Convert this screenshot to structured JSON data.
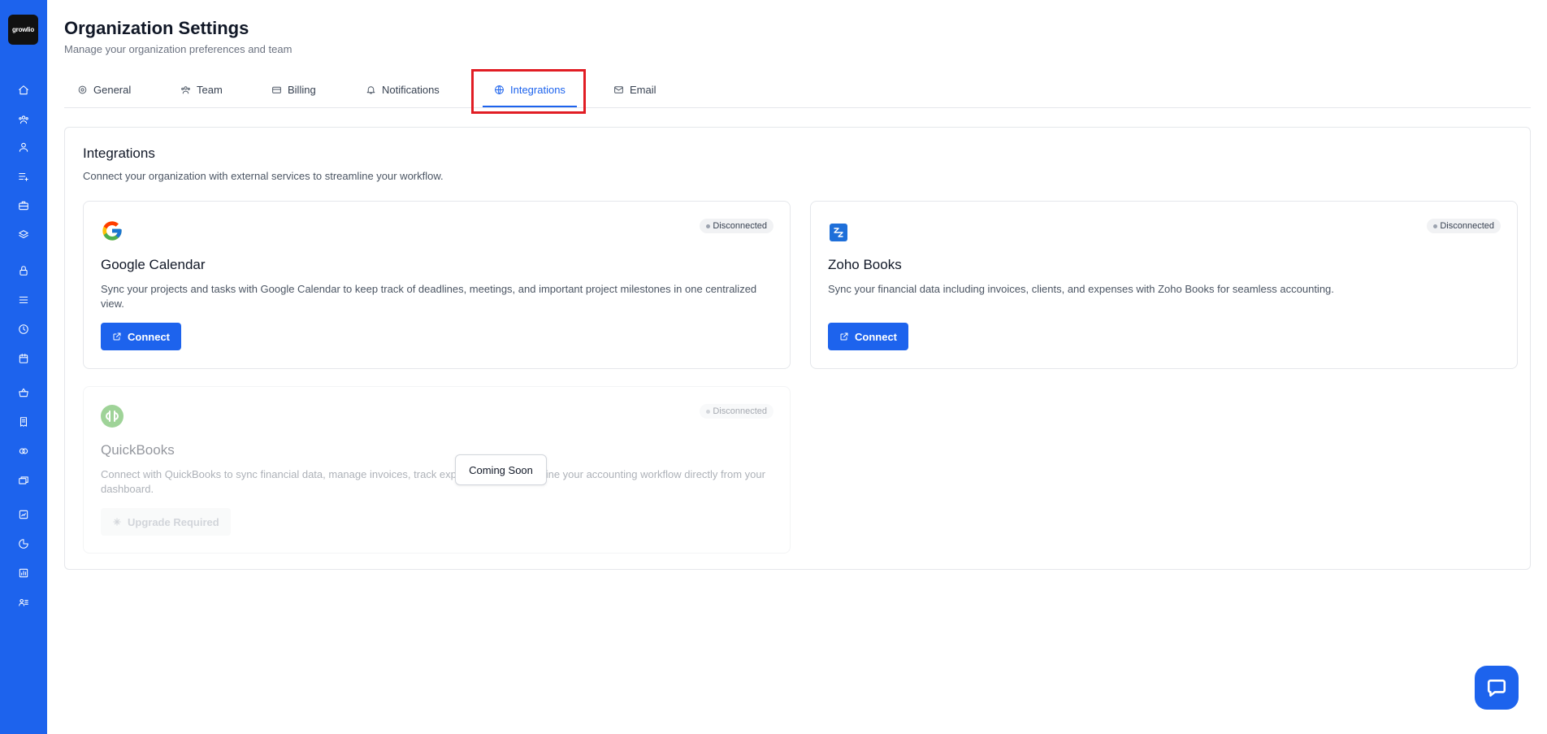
{
  "app": {
    "logo_text": "growlio"
  },
  "sidebar": {
    "items": [
      {
        "icon": "home-icon"
      },
      {
        "icon": "team-icon"
      },
      {
        "icon": "user-icon"
      },
      {
        "icon": "list-plus-icon"
      },
      {
        "icon": "briefcase-icon"
      },
      {
        "icon": "layers-icon"
      },
      {
        "icon": "lock-icon"
      },
      {
        "icon": "menu-icon"
      },
      {
        "icon": "clock-icon"
      },
      {
        "icon": "calendar-icon"
      },
      {
        "icon": "basket-icon"
      },
      {
        "icon": "receipt-icon"
      },
      {
        "icon": "coins-icon"
      },
      {
        "icon": "cards-icon"
      },
      {
        "icon": "report-icon"
      },
      {
        "icon": "pie-chart-icon"
      },
      {
        "icon": "chart-icon"
      },
      {
        "icon": "user-list-icon"
      }
    ]
  },
  "header": {
    "title": "Organization Settings",
    "subtitle": "Manage your organization preferences and team"
  },
  "tabs": [
    {
      "label": "General",
      "icon": "gear-icon"
    },
    {
      "label": "Team",
      "icon": "team-icon"
    },
    {
      "label": "Billing",
      "icon": "credit-card-icon"
    },
    {
      "label": "Notifications",
      "icon": "bell-icon"
    },
    {
      "label": "Integrations",
      "icon": "globe-icon",
      "active": true
    },
    {
      "label": "Email",
      "icon": "mail-icon"
    }
  ],
  "integrations": {
    "title": "Integrations",
    "subtitle": "Connect your organization with external services to streamline your workflow.",
    "cards": [
      {
        "name": "Google Calendar",
        "status": "Disconnected",
        "description": "Sync your projects and tasks with Google Calendar to keep track of deadlines, meetings, and important project milestones in one centralized view.",
        "button": "Connect"
      },
      {
        "name": "Zoho Books",
        "status": "Disconnected",
        "description": "Sync your financial data including invoices, clients, and expenses with Zoho Books for seamless accounting.",
        "button": "Connect"
      },
      {
        "name": "QuickBooks",
        "status": "Disconnected",
        "description": "Connect with QuickBooks to sync financial data, manage invoices, track expenses, and streamline your accounting workflow directly from your dashboard.",
        "button": "Upgrade Required",
        "tooltip": "Coming Soon"
      }
    ]
  },
  "colors": {
    "primary": "#1d63ed",
    "highlight": "#e11d24"
  }
}
